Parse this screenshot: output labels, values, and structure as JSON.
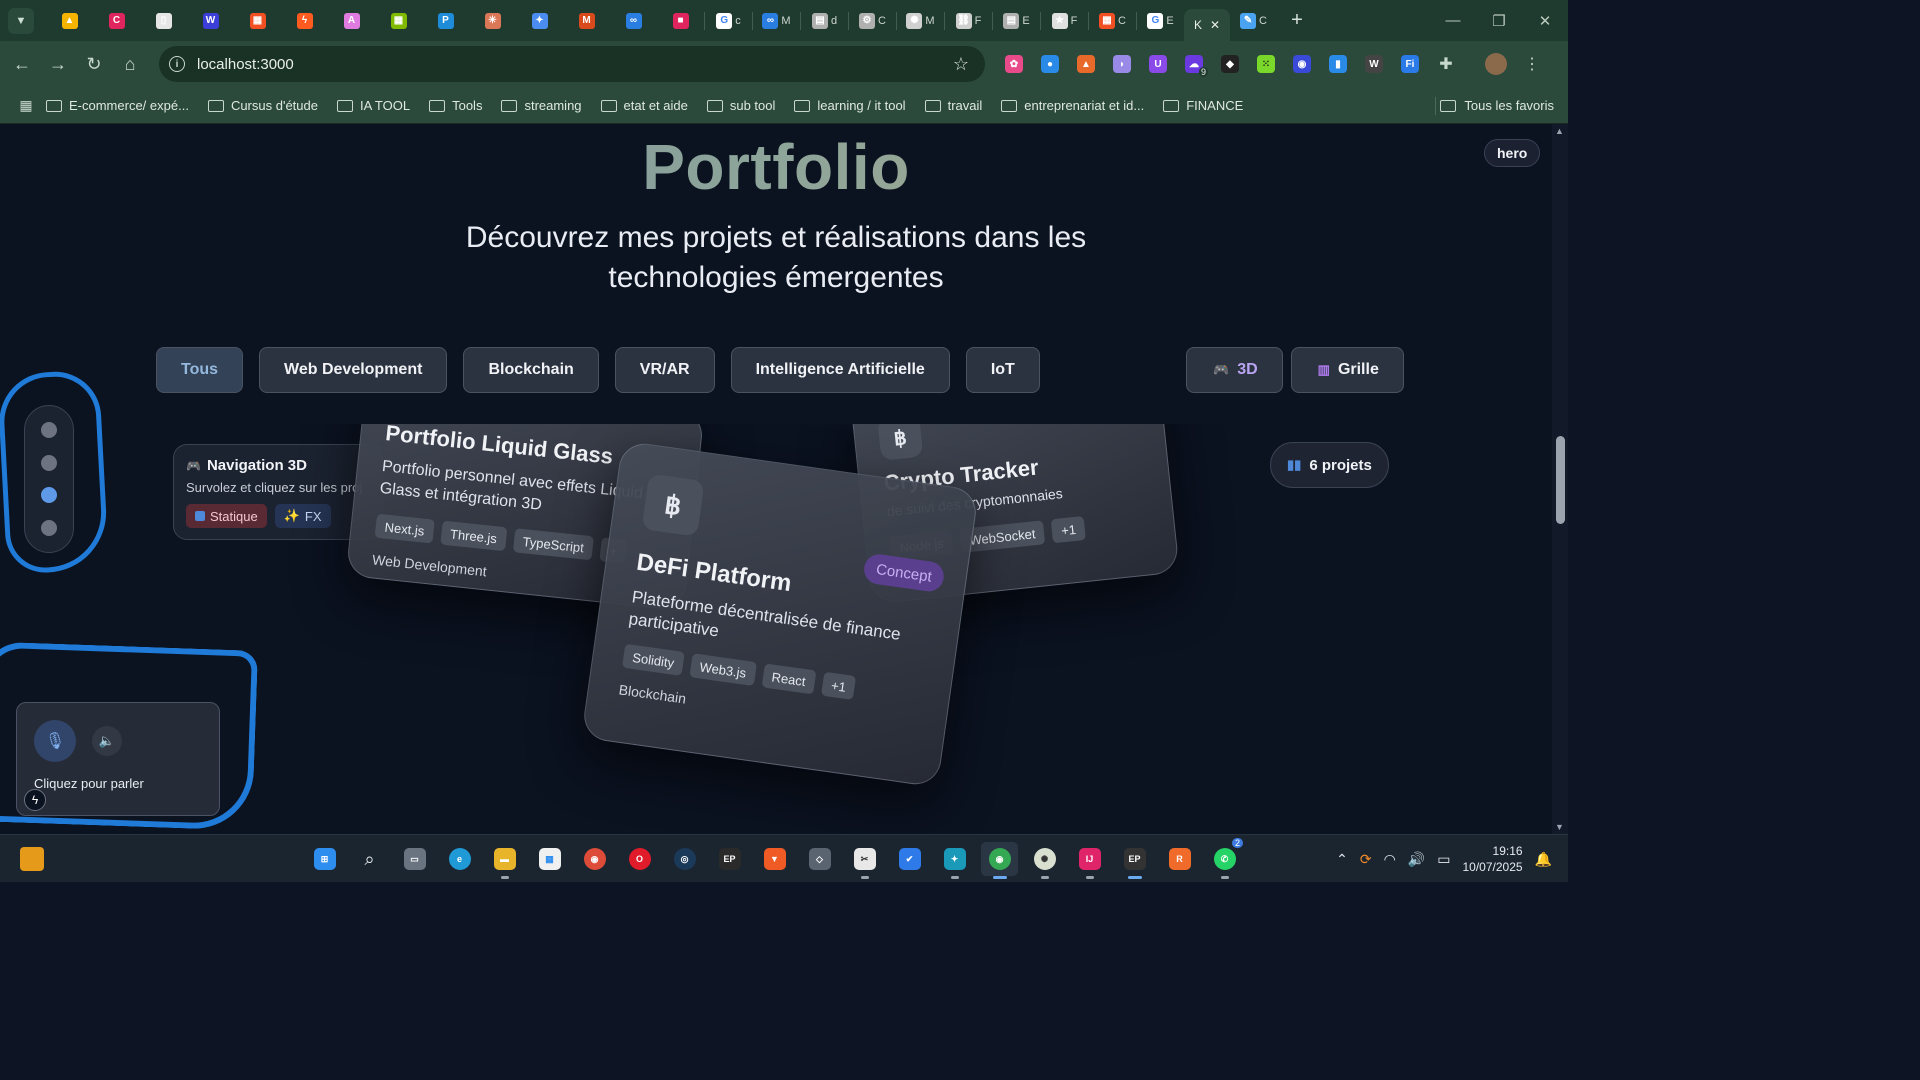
{
  "browser": {
    "tabs": [
      {
        "icon": "drive-icon",
        "color": "#f4b400"
      },
      {
        "icon": "c-icon",
        "color": "#e0245e"
      },
      {
        "icon": "book-icon",
        "color": "#e6e6e6"
      },
      {
        "icon": "w-icon",
        "color": "#3b3fd8"
      },
      {
        "icon": "microsoft-icon",
        "color": "#f25022"
      },
      {
        "icon": "bolt-icon",
        "color": "#ff5a1f"
      },
      {
        "icon": "a-icon",
        "color": "#e07be0"
      },
      {
        "icon": "microsoft-icon",
        "color": "#7fba00"
      },
      {
        "icon": "p-icon",
        "color": "#1e8cd8"
      },
      {
        "icon": "asterisk-icon",
        "color": "#d97757"
      },
      {
        "icon": "sparkle-icon",
        "color": "#4a8cf0"
      },
      {
        "icon": "m-icon",
        "color": "#d84a1b"
      },
      {
        "icon": "meta-icon",
        "color": "#2a7de1"
      },
      {
        "icon": "square-icon",
        "color": "#e0245e"
      },
      {
        "icon": "google-icon",
        "color": "#ffffff",
        "label": "c"
      },
      {
        "icon": "meta-icon",
        "color": "#2a7de1",
        "label": "M"
      },
      {
        "icon": "doc-icon",
        "color": "#b0b0b0",
        "label": "d"
      },
      {
        "icon": "gear-icon",
        "color": "#b0b0b0",
        "label": "C"
      },
      {
        "icon": "openai-icon",
        "color": "#d0d0d0",
        "label": "M"
      },
      {
        "icon": "link-icon",
        "color": "#d0d0d0",
        "label": "F"
      },
      {
        "icon": "doc-icon",
        "color": "#b0b0b0",
        "label": "E"
      },
      {
        "icon": "star-icon",
        "color": "#e0e0e0",
        "label": "F"
      },
      {
        "icon": "microsoft-icon",
        "color": "#f25022",
        "label": "C"
      },
      {
        "icon": "google-icon",
        "color": "#ffffff",
        "label": "E"
      }
    ],
    "active_tab": {
      "label": "K",
      "close": "✕"
    },
    "last_tab": {
      "icon": "pen-icon",
      "color": "#4aa3f0",
      "label": "C"
    },
    "new_tab": "+",
    "url": "localhost:3000",
    "extension_badge": "9",
    "bookmarks": [
      "E-commerce/ expé...",
      "Cursus d'étude",
      "IA TOOL",
      "Tools",
      "streaming",
      "etat et aide",
      "sub tool",
      "learning / it tool",
      "travail",
      "entreprenariat et id...",
      "FINANCE"
    ],
    "all_bookmarks": "Tous les favoris"
  },
  "hero": {
    "title": "Portfolio",
    "subtitle": "Découvrez mes projets et réalisations dans les technologies émergentes",
    "badge": "hero"
  },
  "filters": [
    "Tous",
    "Web Development",
    "Blockchain",
    "VR/AR",
    "Intelligence Artificielle",
    "IoT"
  ],
  "active_filter": "Tous",
  "view_toggle": {
    "three_d": "3D",
    "grid": "Grille"
  },
  "nav3d": {
    "title": "Navigation 3D",
    "desc": "Survolez et cliquez sur les proj",
    "chip_static": "Statique",
    "chip_fx": "FX"
  },
  "count": "6 projets",
  "cards": {
    "liquid": {
      "title": "Portfolio Liquid Glass",
      "desc": "Portfolio personnel avec effets Liquid Glass et intégration 3D",
      "tags": [
        "Next.js",
        "Three.js",
        "TypeScript",
        "+"
      ],
      "category": "Web Development"
    },
    "crypto": {
      "coin": "฿",
      "title": "Crypto Tracker",
      "desc": "de suivi des cryptomonnaies",
      "tags": [
        "Node.js",
        "WebSocket",
        "+1"
      ]
    },
    "defi": {
      "coin": "฿",
      "badge": "Concept",
      "title": "DeFi Platform",
      "desc": "Plateforme décentralisée de finance participative",
      "tags": [
        "Solidity",
        "Web3.js",
        "React",
        "+1"
      ],
      "category": "Blockchain"
    }
  },
  "voice": {
    "hint": "Cliquez pour parler"
  },
  "taskbar": {
    "time": "19:16",
    "date": "10/07/2025",
    "whatsapp_badge": "2"
  }
}
